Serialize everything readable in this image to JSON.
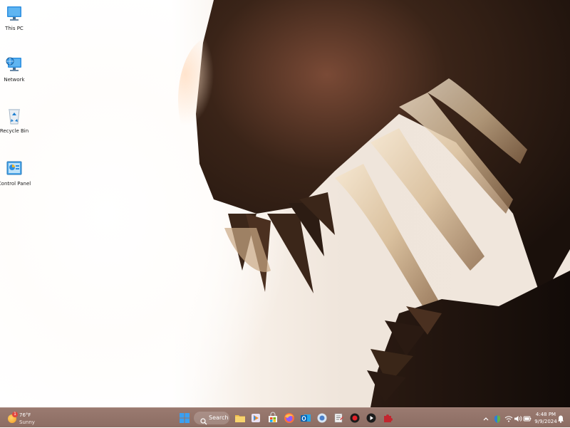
{
  "desktop": {
    "icons": [
      {
        "label": "This PC",
        "icon": "this-pc-icon"
      },
      {
        "label": "Network",
        "icon": "network-icon"
      },
      {
        "label": "Recycle Bin",
        "icon": "recycle-bin-icon"
      },
      {
        "label": "Control Panel",
        "icon": "control-panel-icon"
      }
    ]
  },
  "taskbar": {
    "weather": {
      "temp": "76°F",
      "condition": "Sunny",
      "badge": "1"
    },
    "search_label": "Search",
    "pinned": [
      "windows-start-icon",
      "file-explorer-icon",
      "app-store-icon",
      "microsoft-store-icon",
      "firefox-icon",
      "outlook-icon",
      "browser-icon",
      "notepad-icon",
      "record-icon",
      "media-player-icon",
      "puzzle-app-icon"
    ],
    "tray": {
      "icons": [
        "chevron-up-icon",
        "shield-icon",
        "wifi-icon",
        "speaker-icon",
        "battery-icon",
        "bell-icon"
      ],
      "time": "4:48 PM",
      "date": "9/9/2024"
    }
  },
  "colors": {
    "taskbar": "#8c6d63",
    "accent": "#2f7fd6"
  }
}
